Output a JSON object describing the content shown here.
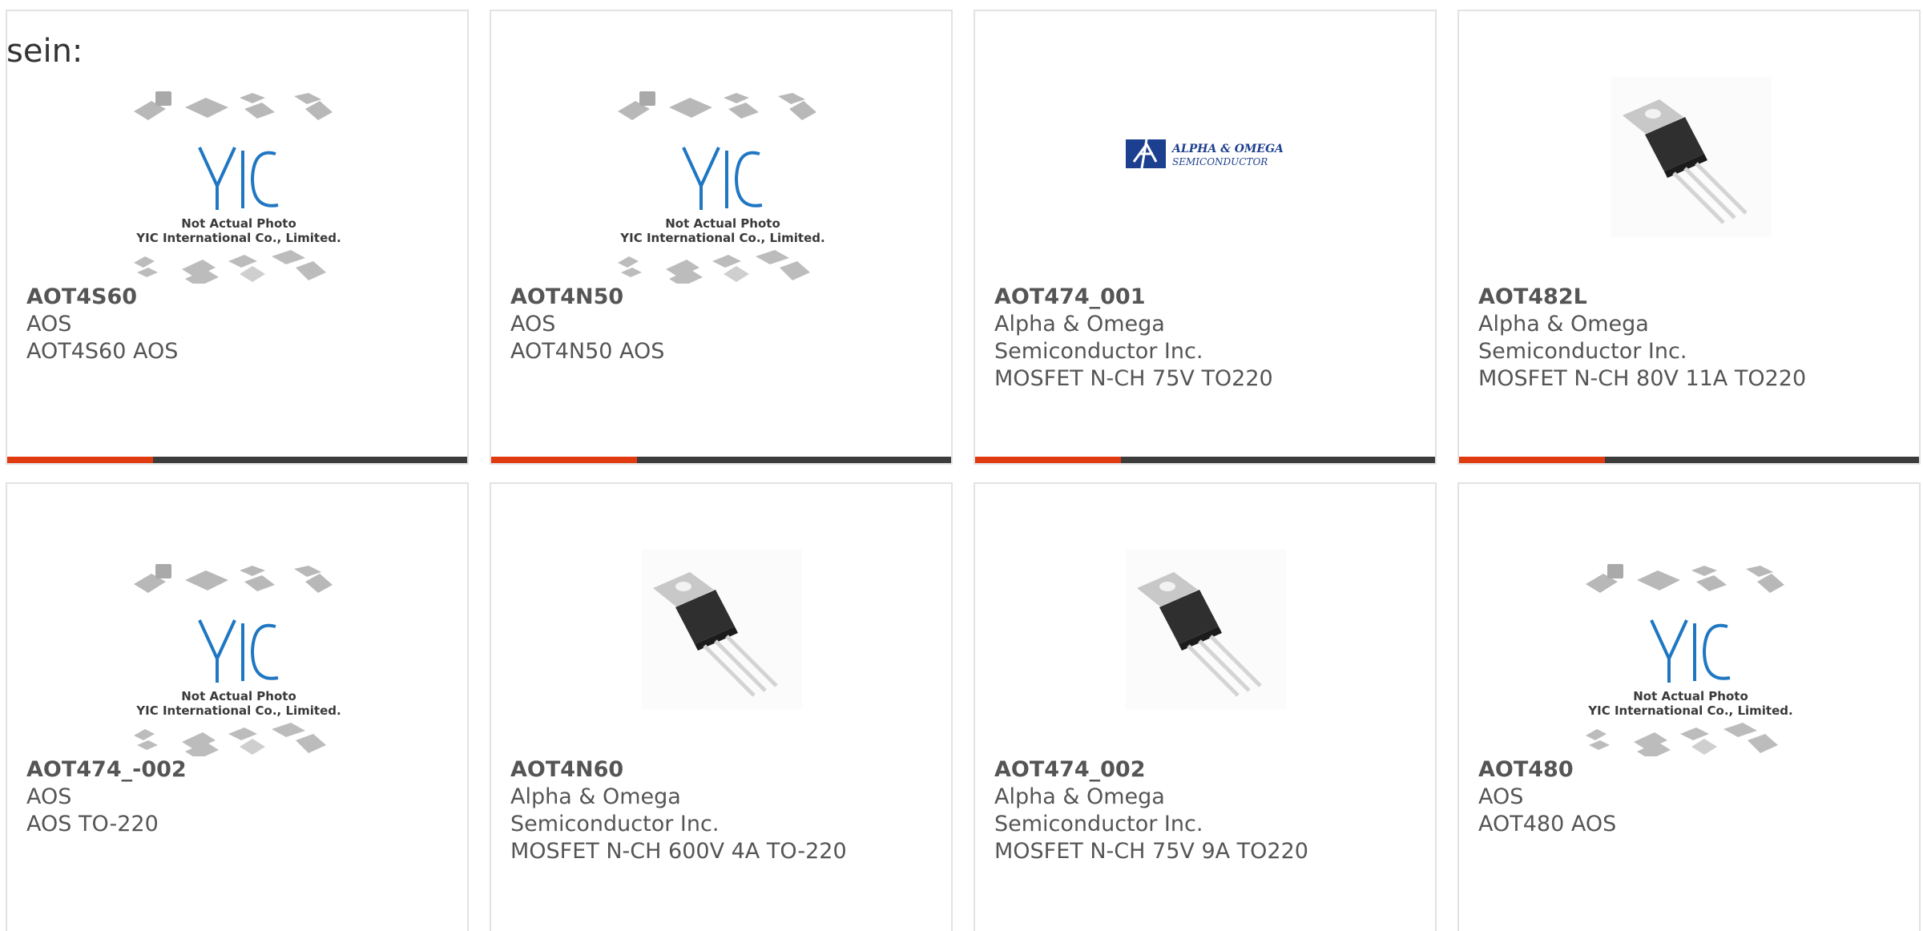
{
  "lead_text": "sein:",
  "colors": {
    "accent": "#e03a10",
    "bar_dark": "#3c3c3c",
    "card_border": "#e2e2e2",
    "text": "#555555",
    "logo_blue": "#1f76c2"
  },
  "placeholder": {
    "line1": "Not Actual Photo",
    "line2": "YIC International Co., Limited.",
    "logo_text": "YIC"
  },
  "manufacturer_logo": {
    "line1": "ALPHA & OMEGA",
    "line2": "SEMICONDUCTOR"
  },
  "products": [
    {
      "image": "yic-placeholder",
      "part_number": "AOT4S60",
      "manufacturer": "AOS",
      "description": "AOT4S60 AOS"
    },
    {
      "image": "yic-placeholder",
      "part_number": "AOT4N50",
      "manufacturer": "AOS",
      "description": "AOT4N50 AOS"
    },
    {
      "image": "alpha-omega-logo",
      "part_number": "AOT474_001",
      "manufacturer": "Alpha & Omega Semiconductor Inc.",
      "description": "MOSFET N-CH 75V TO220"
    },
    {
      "image": "to220-package",
      "part_number": "AOT482L",
      "manufacturer": "Alpha & Omega Semiconductor Inc.",
      "description": "MOSFET N-CH 80V 11A TO220"
    },
    {
      "image": "yic-placeholder",
      "part_number": "AOT474_-002",
      "manufacturer": "AOS",
      "description": "AOS TO-220"
    },
    {
      "image": "to220-package",
      "part_number": "AOT4N60",
      "manufacturer": "Alpha & Omega Semiconductor Inc.",
      "description": "MOSFET N-CH 600V 4A TO-220"
    },
    {
      "image": "to220-package",
      "part_number": "AOT474_002",
      "manufacturer": "Alpha & Omega Semiconductor Inc.",
      "description": "MOSFET N-CH 75V 9A TO220"
    },
    {
      "image": "yic-placeholder",
      "part_number": "AOT480",
      "manufacturer": "AOS",
      "description": "AOT480 AOS"
    }
  ]
}
